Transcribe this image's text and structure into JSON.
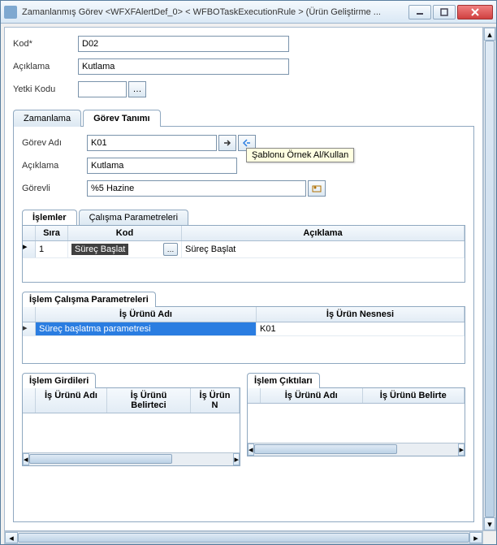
{
  "window": {
    "title": "Zamanlanmış Görev <WFXFAlertDef_0> < WFBOTaskExecutionRule > (Ürün Geliştirme ..."
  },
  "form": {
    "kod_label": "Kod*",
    "kod_value": "D02",
    "aciklama_label": "Açıklama",
    "aciklama_value": "Kutlama",
    "yetki_label": "Yetki Kodu",
    "yetki_value": ""
  },
  "main_tabs": {
    "zamanlama": "Zamanlama",
    "gorev": "Görev Tanımı"
  },
  "gorev": {
    "ad_label": "Görev Adı",
    "ad_value": "K01",
    "aciklama_label": "Açıklama",
    "aciklama_value": "Kutlama",
    "gorevli_label": "Görevli",
    "gorevli_value": "%5 Hazine",
    "tooltip": "Şablonu Örnek Al/Kullan"
  },
  "sub_tabs": {
    "islemler": "İşlemler",
    "params": "Çalışma Parametreleri"
  },
  "islemler_grid": {
    "cols": {
      "sira": "Sıra",
      "kod": "Kod",
      "aciklama": "Açıklama"
    },
    "rows": [
      {
        "sira": "1",
        "kod": "Süreç Başlat",
        "aciklama": "Süreç Başlat"
      }
    ]
  },
  "icp": {
    "title": "İşlem Çalışma Parametreleri",
    "cols": {
      "ad": "İş Ürünü Adı",
      "nesne": "İş Ürün Nesnesi"
    },
    "rows": [
      {
        "ad": "Süreç başlatma parametresi",
        "nesne": "K01"
      }
    ]
  },
  "inputs": {
    "title": "İşlem Girdileri",
    "cols": {
      "ad": "İş Ürünü Adı",
      "belirtec": "İş Ürünü Belirteci",
      "nesne": "İş Ürün N"
    }
  },
  "outputs": {
    "title": "İşlem Çıktıları",
    "cols": {
      "ad": "İş Ürünü Adı",
      "belirtec": "İş Ürünü Belirte"
    }
  }
}
